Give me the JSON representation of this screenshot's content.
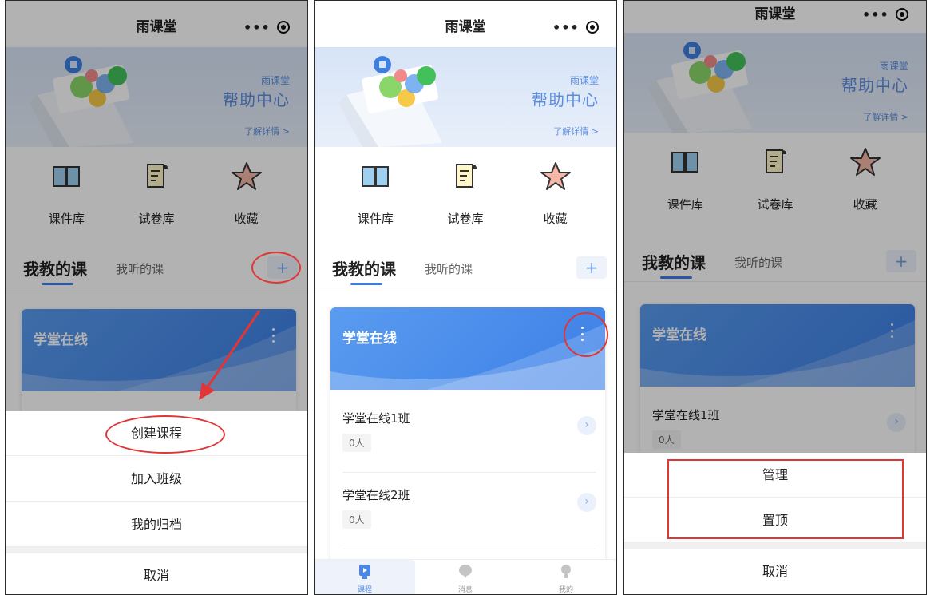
{
  "app": {
    "title": "雨课堂",
    "capsule_more": "•••"
  },
  "banner": {
    "brand": "雨课堂",
    "headline": "帮助中心",
    "link": "了解详情 >"
  },
  "shortcuts": [
    {
      "label": "课件库",
      "icon": "book-icon"
    },
    {
      "label": "试卷库",
      "icon": "paper-icon"
    },
    {
      "label": "收藏",
      "icon": "star-icon"
    }
  ],
  "tabs": {
    "teach": "我教的课",
    "listen": "我听的课",
    "add": "+"
  },
  "course": {
    "title": "学堂在线",
    "classes": [
      {
        "name": "学堂在线1班",
        "count": "0人"
      },
      {
        "name": "学堂在线2班",
        "count": "0人"
      }
    ]
  },
  "chevron": "›",
  "sheet1": {
    "create": "创建课程",
    "join": "加入班级",
    "archive": "我的归档",
    "cancel": "取消"
  },
  "sheet3": {
    "manage": "管理",
    "pin": "置顶",
    "cancel": "取消"
  },
  "bottom_nav": [
    {
      "label": "课程",
      "icon": "course-icon"
    },
    {
      "label": "消息",
      "icon": "message-icon"
    },
    {
      "label": "我的",
      "icon": "profile-icon"
    }
  ],
  "colors": {
    "accent": "#3a7ce8",
    "annotation": "#e23535"
  }
}
